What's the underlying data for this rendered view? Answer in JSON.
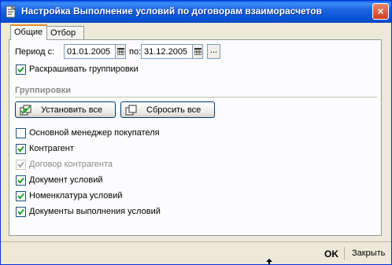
{
  "window": {
    "title": "Настройка Выполнение условий по договорам взаиморасчетов",
    "close_glyph": "×"
  },
  "tabs": [
    {
      "label": "Общие",
      "active": true
    },
    {
      "label": "Отбор",
      "active": false
    }
  ],
  "period": {
    "from_label": "Период с:",
    "from_value": "01.01.2005",
    "to_label": "по:",
    "to_value": "31.12.2005",
    "dots_label": "..."
  },
  "expand_groups": {
    "label": "Раскрашивать группировки",
    "checked": true
  },
  "groupings": {
    "header": "Группировки",
    "set_all_label": "Установить все",
    "reset_all_label": "Сбросить все",
    "items": [
      {
        "label": "Основной менеджер покупателя",
        "checked": false,
        "disabled": false
      },
      {
        "label": "Контрагент",
        "checked": true,
        "disabled": false
      },
      {
        "label": "Договор контрагента",
        "checked": true,
        "disabled": true
      },
      {
        "label": "Документ условий",
        "checked": true,
        "disabled": false
      },
      {
        "label": "Номенклатура условий",
        "checked": true,
        "disabled": false
      },
      {
        "label": "Документы выполнения условий",
        "checked": true,
        "disabled": false
      }
    ]
  },
  "footer": {
    "ok_label": "OK",
    "close_label": "Закрыть"
  },
  "colors": {
    "titlebar": "#0a5ee8",
    "face": "#ece9d8",
    "check": "#21a121"
  }
}
